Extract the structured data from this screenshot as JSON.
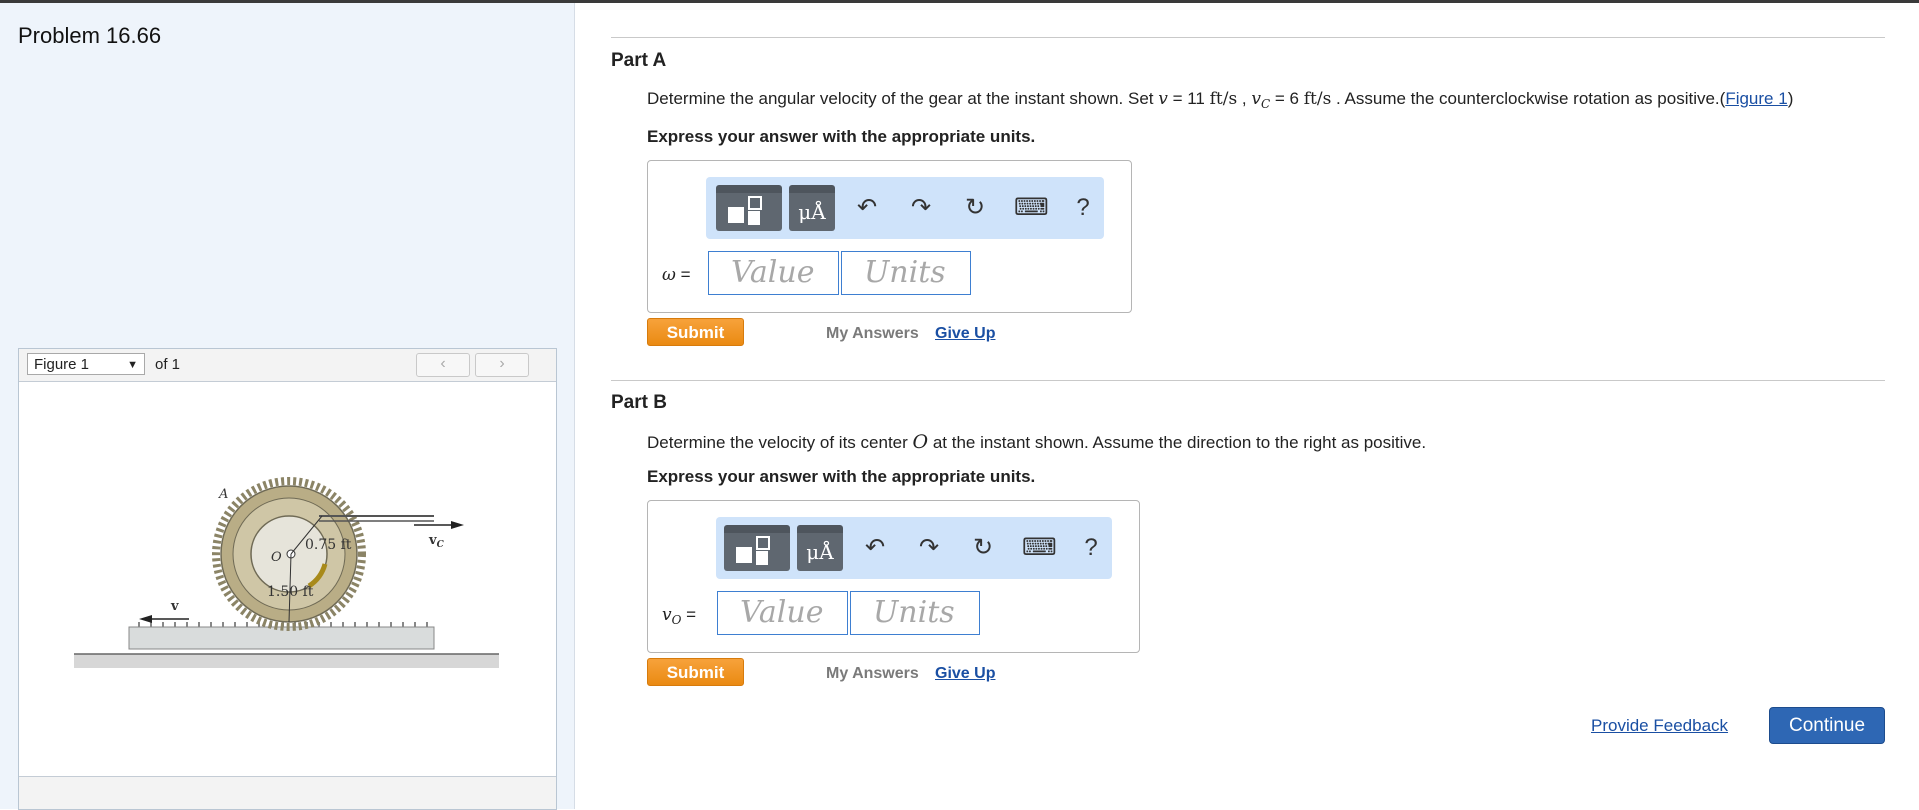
{
  "problem": {
    "title": "Problem 16.66"
  },
  "figure_panel": {
    "selected": "Figure 1",
    "of_text": "of 1",
    "prev_icon": "chevron-left-icon",
    "next_icon": "chevron-right-icon",
    "figure_labels": {
      "a": "A",
      "o": "O",
      "r_inner": "0.75 ft",
      "r_outer": "1.50 ft",
      "v": "v",
      "vc": "v",
      "vc_sub": "C"
    }
  },
  "partA": {
    "title": "Part A",
    "q_prefix": "Determine the angular velocity of the gear at the instant shown. Set ",
    "q_v": "v",
    "q_eq1": " = 11 ",
    "q_unit1": "ft/s",
    "q_sep": " , ",
    "q_vc": "v",
    "q_vc_sub": "C",
    "q_eq2": " = 6 ",
    "q_unit2": "ft/s",
    "q_suffix": " . Assume the counterclockwise rotation as positive.(",
    "q_link": "Figure 1",
    "q_close": ")",
    "express": "Express your answer with the appropriate units.",
    "var_label": "ω",
    "var_eq": " =",
    "value_placeholder": "Value",
    "units_placeholder": "Units",
    "submit": "Submit",
    "my_answers": "My Answers",
    "give_up": "Give Up"
  },
  "partB": {
    "title": "Part B",
    "q_prefix": "Determine the velocity of its center ",
    "q_o": "O",
    "q_suffix": " at the instant shown. Assume the direction to the right as positive.",
    "express": "Express your answer with the appropriate units.",
    "var_label": "v",
    "var_sub": "O",
    "var_eq": " =",
    "value_placeholder": "Value",
    "units_placeholder": "Units",
    "submit": "Submit",
    "my_answers": "My Answers",
    "give_up": "Give Up"
  },
  "toolbar": {
    "units_glyph": "μÅ",
    "undo_glyph": "↶",
    "redo_glyph": "↷",
    "reset_glyph": "↻",
    "keyboard_glyph": "⌨",
    "help_glyph": "?"
  },
  "footer": {
    "feedback": "Provide Feedback",
    "continue": "Continue"
  },
  "colors": {
    "accent_blue": "#2e67b4",
    "submit_orange": "#ea8a12",
    "left_panel_bg": "#eef4fb",
    "toolbar_bg": "#cfe3fa"
  }
}
